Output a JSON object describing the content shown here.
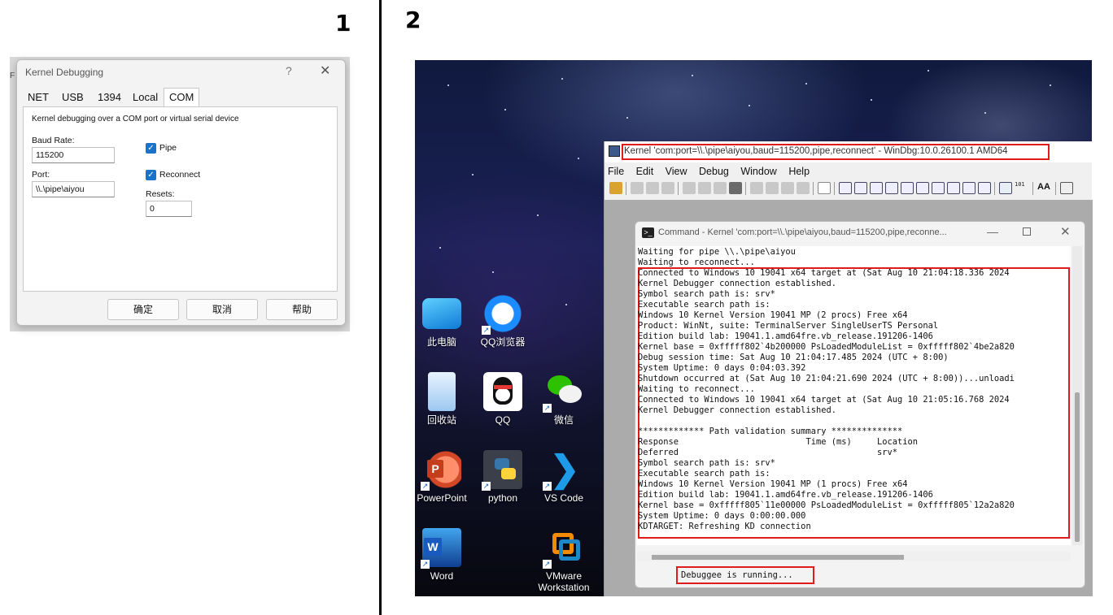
{
  "steps": {
    "first": "1",
    "second": "2"
  },
  "dialog": {
    "backdrop_fragment": "F",
    "title": "Kernel Debugging",
    "help_glyph": "?",
    "close_glyph": "✕",
    "tabs": [
      "NET",
      "USB",
      "1394",
      "Local",
      "COM"
    ],
    "description": "Kernel debugging over a COM port or virtual serial device",
    "baud_label": "Baud Rate:",
    "baud_value": "115200",
    "port_label": "Port:",
    "port_value": "\\\\.\\pipe\\aiyou",
    "pipe_label": "Pipe",
    "reconnect_label": "Reconnect",
    "resets_label": "Resets:",
    "resets_value": "0",
    "buttons": {
      "ok": "确定",
      "cancel": "取消",
      "help": "帮助"
    }
  },
  "desktop": {
    "icons": {
      "this_pc": "此电脑",
      "qq_browser": "QQ浏览器",
      "recycle_bin": "回收站",
      "qq": "QQ",
      "wechat": "微信",
      "powerpoint": "PowerPoint",
      "python": "python",
      "vscode": "VS Code",
      "word": "Word",
      "vmware": "VMware Workstation"
    },
    "icon_glyphs": {
      "powerpoint": "P",
      "word": "W",
      "vscode": "❯",
      "arrow": "↗"
    }
  },
  "windbg": {
    "title": "Kernel 'com:port=\\\\.\\pipe\\aiyou,baud=115200,pipe,reconnect' - WinDbg:10.0.26100.1 AMD64",
    "menu": [
      "File",
      "Edit",
      "View",
      "Debug",
      "Window",
      "Help"
    ],
    "toolbar_text": {
      "binary": "101",
      "font": "AA"
    }
  },
  "command": {
    "title": "Command - Kernel 'com:port=\\\\.\\pipe\\aiyou,baud=115200,pipe,reconne...",
    "icon_glyph": ">_",
    "min_glyph": "—",
    "close_glyph": "✕",
    "lines": [
      "Waiting for pipe \\\\.\\pipe\\aiyou",
      "Waiting to reconnect...",
      "Connected to Windows 10 19041 x64 target at (Sat Aug 10 21:04:18.336 2024",
      "Kernel Debugger connection established.",
      "Symbol search path is: srv*",
      "Executable search path is:",
      "Windows 10 Kernel Version 19041 MP (2 procs) Free x64",
      "Product: WinNt, suite: TerminalServer SingleUserTS Personal",
      "Edition build lab: 19041.1.amd64fre.vb_release.191206-1406",
      "Kernel base = 0xfffff802`4b200000 PsLoadedModuleList = 0xfffff802`4be2a820",
      "Debug session time: Sat Aug 10 21:04:17.485 2024 (UTC + 8:00)",
      "System Uptime: 0 days 0:04:03.392",
      "Shutdown occurred at (Sat Aug 10 21:04:21.690 2024 (UTC + 8:00))...unloadi",
      "Waiting to reconnect...",
      "Connected to Windows 10 19041 x64 target at (Sat Aug 10 21:05:16.768 2024",
      "Kernel Debugger connection established.",
      "",
      "************* Path validation summary **************",
      "Response                         Time (ms)     Location",
      "Deferred                                       srv*",
      "Symbol search path is: srv*",
      "Executable search path is:",
      "Windows 10 Kernel Version 19041 MP (1 procs) Free x64",
      "Edition build lab: 19041.1.amd64fre.vb_release.191206-1406",
      "Kernel base = 0xfffff805`11e00000 PsLoadedModuleList = 0xfffff805`12a2a820",
      "System Uptime: 0 days 0:00:00.000",
      "KDTARGET: Refreshing KD connection"
    ],
    "status": "Debuggee is running..."
  },
  "colors": {
    "highlight": "#e01b1b",
    "checkbox": "#1a73c9"
  }
}
